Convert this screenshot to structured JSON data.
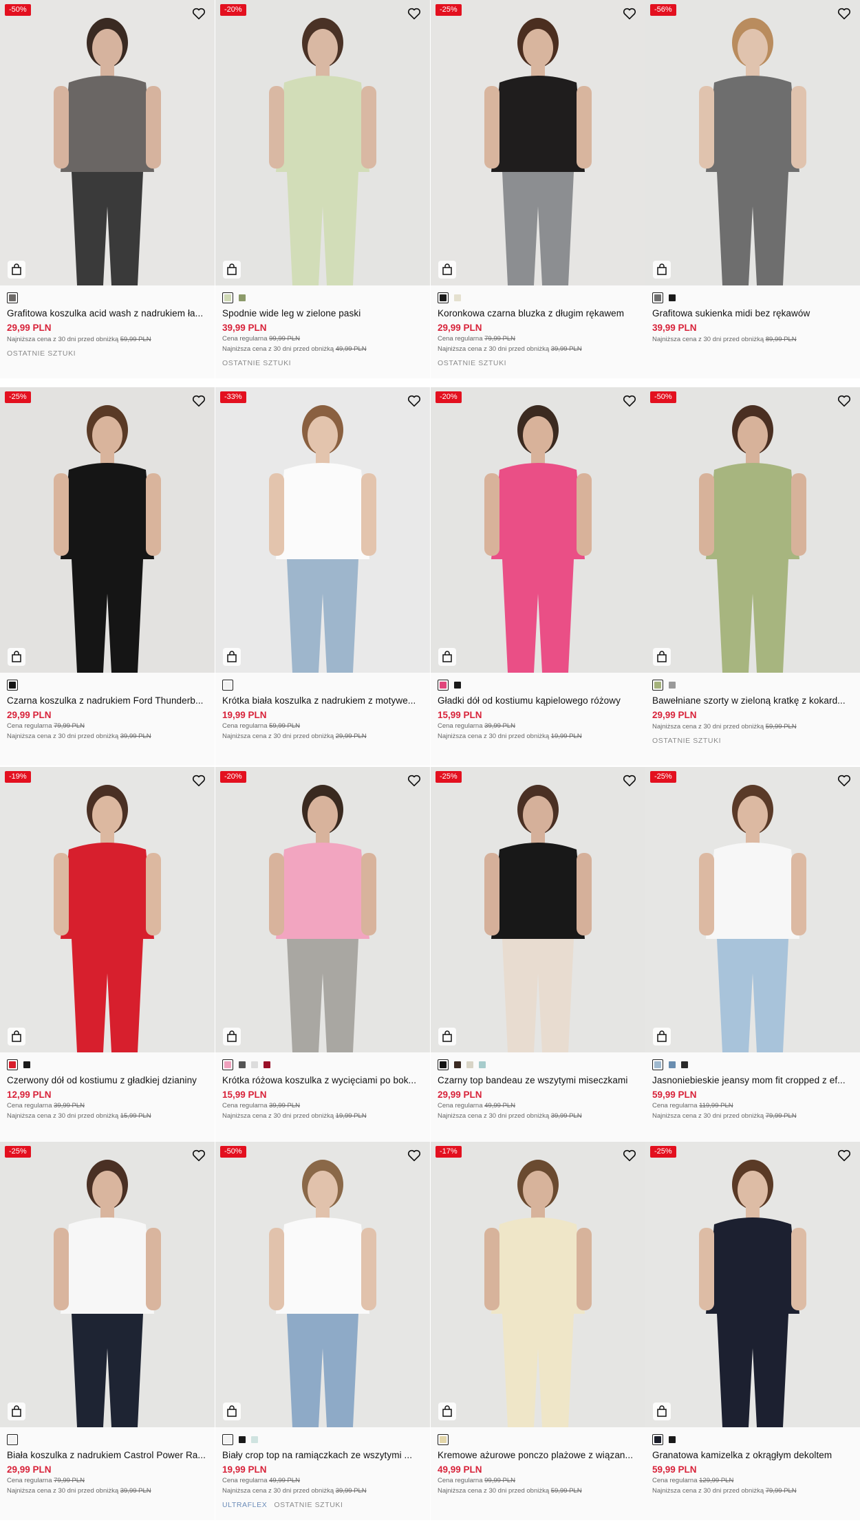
{
  "currency_note": "PLN",
  "labels": {
    "regular": "Cena regularna",
    "lowest": "Najniższa cena z 30 dni przed obniżką"
  },
  "products": [
    {
      "name": "Grafitowa koszulka acid wash z nadrukiem ła...",
      "discount": "-50%",
      "price": "29,99 PLN",
      "regular": "",
      "lowest": "59,99 PLN",
      "tag": "OSTATNIE SZTUKI",
      "tag2": "",
      "swatches": [
        "#6d6a68"
      ],
      "bg": "#e7e6e4",
      "garment": "#6a6664",
      "lower": "#3a3a3a",
      "skin": "#d6b39e",
      "hair": "#3a2a22"
    },
    {
      "name": "Spodnie wide leg w zielone paski",
      "discount": "-20%",
      "price": "39,99 PLN",
      "regular": "99,99 PLN",
      "lowest": "49,99 PLN",
      "tag": "OSTATNIE SZTUKI",
      "tag2": "",
      "swatches": [
        "#cfd9b5",
        "#8c9a6a"
      ],
      "bg": "#e4e4e2",
      "garment": "#d2ddb8",
      "lower": "#d2ddb8",
      "skin": "#d9b8a3",
      "hair": "#4a3226"
    },
    {
      "name": "Koronkowa czarna bluzka z długim rękawem",
      "discount": "-25%",
      "price": "29,99 PLN",
      "regular": "79,99 PLN",
      "lowest": "39,99 PLN",
      "tag": "OSTATNIE SZTUKI",
      "tag2": "",
      "swatches": [
        "#1b1b1b",
        "#e4e0cf"
      ],
      "bg": "#e6e5e3",
      "garment": "#1f1d1d",
      "lower": "#8c8e91",
      "skin": "#d8b59e",
      "hair": "#4b2e20"
    },
    {
      "name": "Grafitowa sukienka midi bez rękawów",
      "discount": "-56%",
      "price": "39,99 PLN",
      "regular": "",
      "lowest": "89,99 PLN",
      "tag": "",
      "tag2": "",
      "swatches": [
        "#6f6f6f",
        "#1a1a1a"
      ],
      "bg": "#e5e5e3",
      "garment": "#6e6e6e",
      "lower": "#6e6e6e",
      "skin": "#e0c3ae",
      "hair": "#b98c5e"
    },
    {
      "name": "Czarna koszulka z nadrukiem Ford Thunderb...",
      "discount": "-25%",
      "price": "29,99 PLN",
      "regular": "79,99 PLN",
      "lowest": "39,99 PLN",
      "tag": "",
      "tag2": "",
      "swatches": [
        "#151515"
      ],
      "bg": "#e3e2e0",
      "garment": "#151515",
      "lower": "#151515",
      "skin": "#d9b49c",
      "hair": "#5a3a26"
    },
    {
      "name": "Krótka biała koszulka z nadrukiem z motywe...",
      "discount": "-33%",
      "price": "19,99 PLN",
      "regular": "59,99 PLN",
      "lowest": "29,99 PLN",
      "tag": "",
      "tag2": "",
      "swatches": [
        "#f2f2f2"
      ],
      "bg": "#e9e9e9",
      "garment": "#fbfbfb",
      "lower": "#9eb6cc",
      "skin": "#e3c4ad",
      "hair": "#8a6040"
    },
    {
      "name": "Gładki dół od kostiumu kąpielowego różowy",
      "discount": "-20%",
      "price": "15,99 PLN",
      "regular": "39,99 PLN",
      "lowest": "19,99 PLN",
      "tag": "",
      "tag2": "",
      "swatches": [
        "#e0457a",
        "#1a1a1a"
      ],
      "bg": "#e4e4e2",
      "garment": "#ea4f86",
      "lower": "#ea4f86",
      "skin": "#d8b29a",
      "hair": "#3b2a20"
    },
    {
      "name": "Bawełniane szorty w zieloną kratkę z kokard...",
      "discount": "-50%",
      "price": "29,99 PLN",
      "regular": "",
      "lowest": "59,99 PLN",
      "tag": "OSTATNIE SZTUKI",
      "tag2": "",
      "swatches": [
        "#a4b27c",
        "#9a9a9a"
      ],
      "bg": "#e4e4e2",
      "garment": "#a7b57f",
      "lower": "#a7b57f",
      "skin": "#d7b29a",
      "hair": "#4a2f22"
    },
    {
      "name": "Czerwony dół od kostiumu z gładkiej dzianiny",
      "discount": "-19%",
      "price": "12,99 PLN",
      "regular": "39,99 PLN",
      "lowest": "15,99 PLN",
      "tag": "",
      "tag2": "",
      "swatches": [
        "#d81e2c",
        "#1a1a1a"
      ],
      "bg": "#e6e6e4",
      "garment": "#d71f2d",
      "lower": "#d71f2d",
      "skin": "#dcb8a0",
      "hair": "#4a3024"
    },
    {
      "name": "Krótka różowa koszulka z wycięciami po bok...",
      "discount": "-20%",
      "price": "15,99 PLN",
      "regular": "39,99 PLN",
      "lowest": "19,99 PLN",
      "tag": "",
      "tag2": "",
      "swatches": [
        "#efa1bd",
        "#555555",
        "#dcdcdc",
        "#9a1028"
      ],
      "bg": "#e5e5e3",
      "garment": "#f2a5c0",
      "lower": "#a9a7a2",
      "skin": "#d8b39c",
      "hair": "#3a2a20"
    },
    {
      "name": "Czarny top bandeau ze wszytymi miseczkami",
      "discount": "-25%",
      "price": "29,99 PLN",
      "regular": "49,99 PLN",
      "lowest": "39,99 PLN",
      "tag": "",
      "tag2": "",
      "swatches": [
        "#151515",
        "#3a2a22",
        "#d8d4c6",
        "#a7cccc"
      ],
      "bg": "#e5e5e3",
      "garment": "#181818",
      "lower": "#e8dcd0",
      "skin": "#d5b09a",
      "hair": "#4a3024"
    },
    {
      "name": "Jasnoniebieskie jeansy mom fit cropped z ef...",
      "discount": "-25%",
      "price": "59,99 PLN",
      "regular": "119,99 PLN",
      "lowest": "79,99 PLN",
      "tag": "",
      "tag2": "",
      "swatches": [
        "#9fb9cf",
        "#6a8eb0",
        "#2a2a2a"
      ],
      "bg": "#e6e6e4",
      "garment": "#f7f7f7",
      "lower": "#a8c3da",
      "skin": "#dcb9a2",
      "hair": "#5a3a28"
    },
    {
      "name": "Biała koszulka z nadrukiem Castrol Power Ra...",
      "discount": "-25%",
      "price": "29,99 PLN",
      "regular": "79,99 PLN",
      "lowest": "39,99 PLN",
      "tag": "",
      "tag2": "",
      "swatches": [
        "#f3f3f3"
      ],
      "bg": "#e5e5e3",
      "garment": "#f7f7f7",
      "lower": "#1e2433",
      "skin": "#d9b59e",
      "hair": "#4a3024"
    },
    {
      "name": "Biały crop top na ramiączkach ze wszytymi ...",
      "discount": "-50%",
      "price": "19,99 PLN",
      "regular": "49,99 PLN",
      "lowest": "39,99 PLN",
      "tag": "OSTATNIE SZTUKI",
      "tag2": "ULTRAFLEX",
      "swatches": [
        "#f3f3f3",
        "#1a1a1a",
        "#cfe3e0"
      ],
      "bg": "#e6e6e4",
      "garment": "#fafafa",
      "lower": "#8eaac7",
      "skin": "#e1c2ac",
      "hair": "#8a6848"
    },
    {
      "name": "Kremowe ażurowe ponczo plażowe z wiązan...",
      "discount": "-17%",
      "price": "49,99 PLN",
      "regular": "99,99 PLN",
      "lowest": "59,99 PLN",
      "tag": "",
      "tag2": "",
      "swatches": [
        "#e3d6a9"
      ],
      "bg": "#e5e5e3",
      "garment": "#efe6c8",
      "lower": "#efe6c8",
      "skin": "#d7b39b",
      "hair": "#6a4a30"
    },
    {
      "name": "Granatowa kamizelka z okrągłym dekoltem",
      "discount": "-25%",
      "price": "59,99 PLN",
      "regular": "129,99 PLN",
      "lowest": "79,99 PLN",
      "tag": "",
      "tag2": "",
      "swatches": [
        "#1a1d2a",
        "#1a1a1a"
      ],
      "bg": "#e6e6e4",
      "garment": "#1c2030",
      "lower": "#1c2030",
      "skin": "#ddbca5",
      "hair": "#5a3a26"
    }
  ]
}
